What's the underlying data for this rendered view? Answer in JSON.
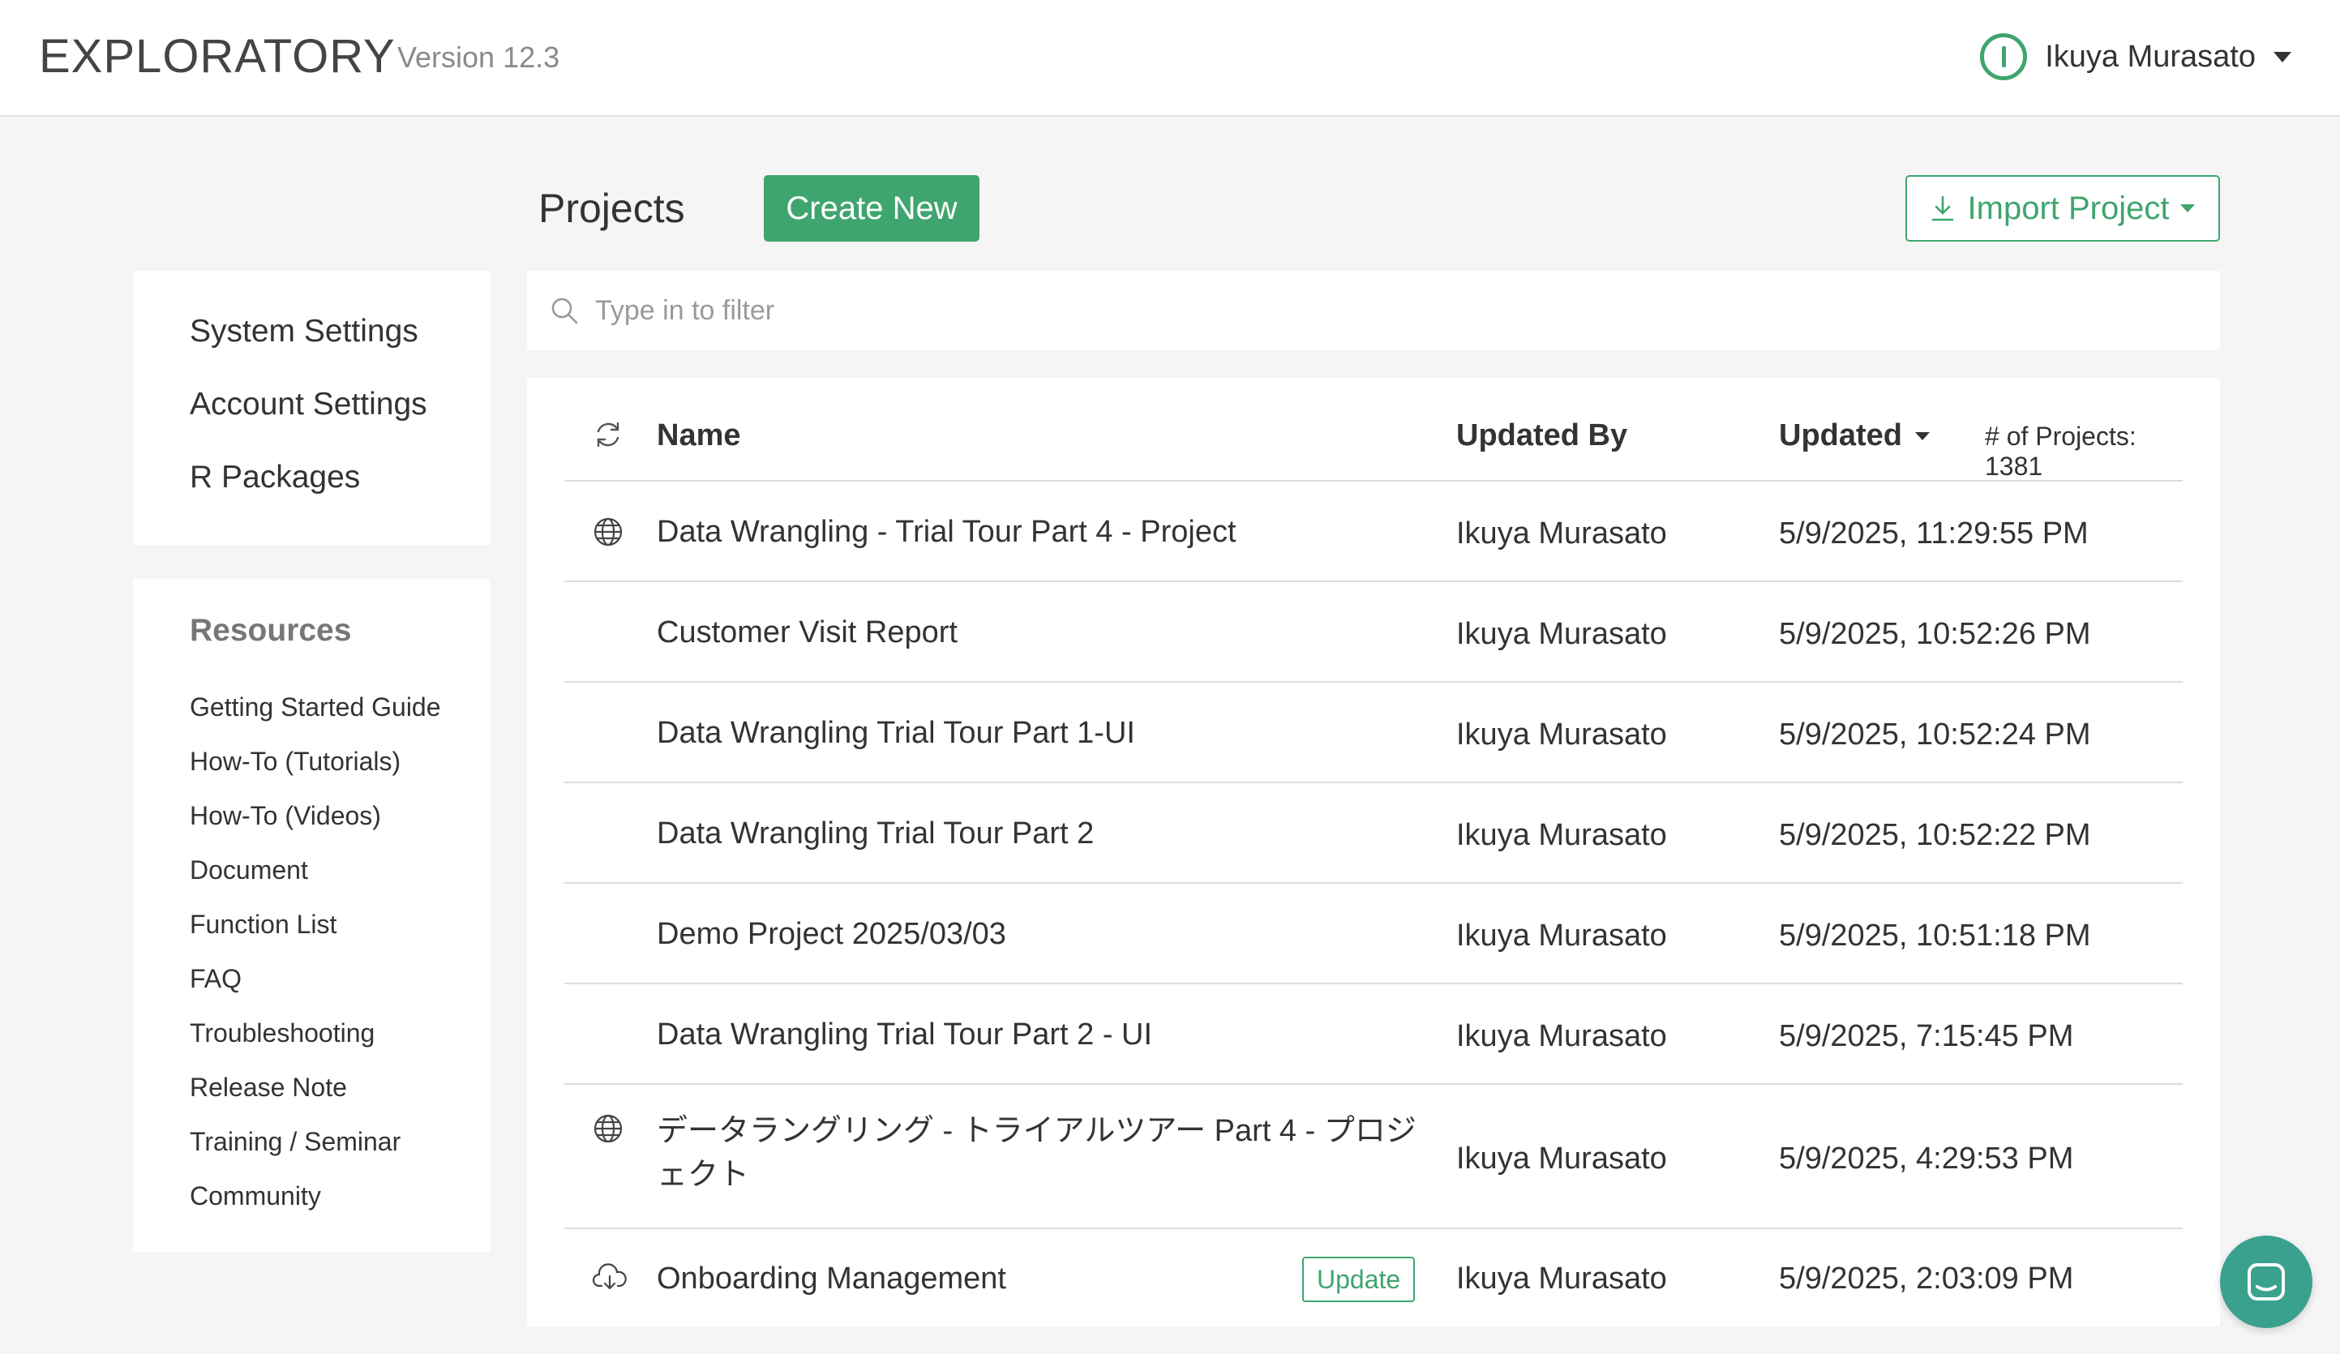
{
  "header": {
    "brand": "EXPLORATORY",
    "version": "Version 12.3",
    "user_name": "Ikuya Murasato"
  },
  "sidebar": {
    "settings": [
      {
        "label": "System Settings"
      },
      {
        "label": "Account Settings"
      },
      {
        "label": "R Packages"
      }
    ],
    "resources_title": "Resources",
    "resources": [
      {
        "label": "Getting Started Guide"
      },
      {
        "label": "How-To (Tutorials)"
      },
      {
        "label": "How-To (Videos)"
      },
      {
        "label": "Document"
      },
      {
        "label": "Function List"
      },
      {
        "label": "FAQ"
      },
      {
        "label": "Troubleshooting"
      },
      {
        "label": "Release Note"
      },
      {
        "label": "Training / Seminar"
      },
      {
        "label": "Community"
      }
    ]
  },
  "main": {
    "title": "Projects",
    "create_label": "Create New",
    "import_label": "Import Project",
    "filter_placeholder": "Type in to filter"
  },
  "table": {
    "headers": {
      "name": "Name",
      "updated_by": "Updated By",
      "updated": "Updated",
      "count": "# of Projects: 1381"
    },
    "rows": [
      {
        "icon": "globe-icon",
        "name": "Data Wrangling - Trial Tour Part 4 - Project",
        "updated_by": "Ikuya Murasato",
        "updated": "5/9/2025, 11:29:55 PM",
        "badge": ""
      },
      {
        "icon": "",
        "name": "Customer Visit Report",
        "updated_by": "Ikuya Murasato",
        "updated": "5/9/2025, 10:52:26 PM",
        "badge": ""
      },
      {
        "icon": "",
        "name": "Data Wrangling Trial Tour Part 1-UI",
        "updated_by": "Ikuya Murasato",
        "updated": "5/9/2025, 10:52:24 PM",
        "badge": ""
      },
      {
        "icon": "",
        "name": "Data Wrangling Trial Tour Part 2",
        "updated_by": "Ikuya Murasato",
        "updated": "5/9/2025, 10:52:22 PM",
        "badge": ""
      },
      {
        "icon": "",
        "name": "Demo Project 2025/03/03",
        "updated_by": "Ikuya Murasato",
        "updated": "5/9/2025, 10:51:18 PM",
        "badge": ""
      },
      {
        "icon": "",
        "name": "Data Wrangling Trial Tour Part 2 - UI",
        "updated_by": "Ikuya Murasato",
        "updated": "5/9/2025, 7:15:45 PM",
        "badge": ""
      },
      {
        "icon": "globe-icon",
        "name": "データラングリング - トライアルツアー Part 4 - プロジェクト",
        "updated_by": "Ikuya Murasato",
        "updated": "5/9/2025, 4:29:53 PM",
        "badge": ""
      },
      {
        "icon": "cloud-download-icon",
        "name": "Onboarding Management",
        "updated_by": "Ikuya Murasato",
        "updated": "5/9/2025, 2:03:09 PM",
        "badge": "Update"
      }
    ]
  },
  "colors": {
    "accent": "#3fa56e",
    "chat": "#3aa18e"
  }
}
